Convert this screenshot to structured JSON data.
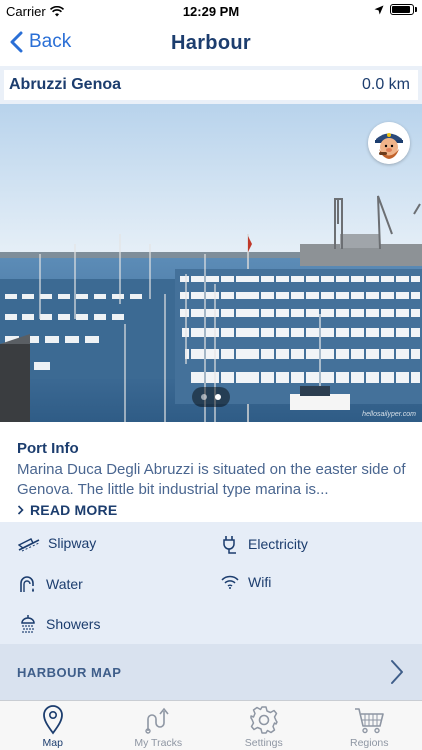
{
  "status_bar": {
    "carrier": "Carrier",
    "time": "12:29 PM",
    "battery_level": 0.95
  },
  "nav": {
    "back_label": "Back",
    "title": "Harbour"
  },
  "location": {
    "name": "Abruzzi Genoa",
    "distance": "0.0 km"
  },
  "photo": {
    "watermark": "hellosailyper.com",
    "pages": 2,
    "current_page": 1
  },
  "port_info": {
    "heading": "Port Info",
    "text": "Marina Duca Degli Abruzzi is situated on the easter side of Genova. The little bit industrial type marina is...",
    "read_more": "READ MORE"
  },
  "amenities": [
    {
      "icon": "slipway-icon",
      "label": "Slipway"
    },
    {
      "icon": "electricity-icon",
      "label": "Electricity"
    },
    {
      "icon": "water-icon",
      "label": "Water"
    },
    {
      "icon": "wifi-icon",
      "label": "Wifi"
    },
    {
      "icon": "showers-icon",
      "label": "Showers"
    }
  ],
  "harbour_map": {
    "label": "HARBOUR MAP"
  },
  "tabs": [
    {
      "icon": "map-pin-icon",
      "label": "Map",
      "active": true
    },
    {
      "icon": "tracks-icon",
      "label": "My Tracks",
      "active": false
    },
    {
      "icon": "gear-icon",
      "label": "Settings",
      "active": false
    },
    {
      "icon": "cart-icon",
      "label": "Regions",
      "active": false
    }
  ],
  "colors": {
    "accent": "#2a6fd6",
    "navy": "#1c3d6e",
    "amenities_bg": "#e6edf7",
    "map_bar_bg": "#d9e2ef"
  }
}
